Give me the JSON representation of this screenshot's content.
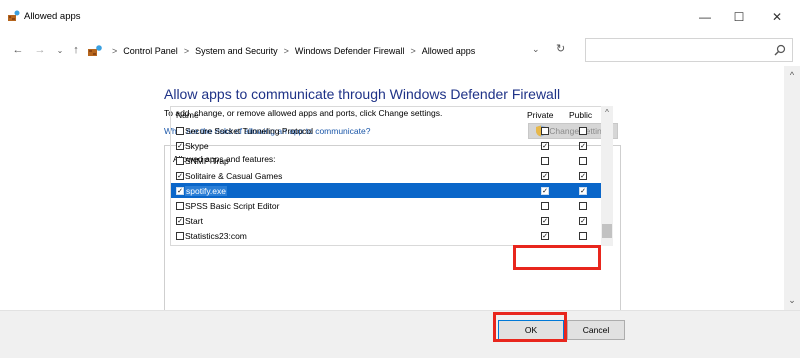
{
  "window": {
    "title": "Allowed apps",
    "minimize_glyph": "—",
    "maximize_glyph": "☐",
    "close_glyph": "✕"
  },
  "nav": {
    "back_glyph": "←",
    "forward_glyph": "→",
    "recent_glyph": "⌄",
    "up_glyph": "↑",
    "crumbs": [
      "Control Panel",
      "System and Security",
      "Windows Defender Firewall",
      "Allowed apps"
    ],
    "separator": ">",
    "dropdown_glyph": "⌄",
    "refresh_glyph": "↻",
    "search_placeholder": ""
  },
  "main": {
    "heading": "Allow apps to communicate through Windows Defender Firewall",
    "subtitle": "To add, change, or remove allowed apps and ports, click Change settings.",
    "risk_link": "What are the risks of allowing an app to communicate?",
    "change_settings_label": "Change settings",
    "group_label": "Allowed apps and features:",
    "columns": {
      "name": "Name",
      "private": "Private",
      "public": "Public"
    },
    "rows": [
      {
        "name": "Secure Socket Tunneling Protocol",
        "enabled": false,
        "private": false,
        "public": false,
        "selected": false
      },
      {
        "name": "Skype",
        "enabled": true,
        "private": true,
        "public": true,
        "selected": false
      },
      {
        "name": "SNMP Trap",
        "enabled": false,
        "private": false,
        "public": false,
        "selected": false
      },
      {
        "name": "Solitaire & Casual Games",
        "enabled": true,
        "private": true,
        "public": true,
        "selected": false
      },
      {
        "name": "spotify.exe",
        "enabled": true,
        "private": true,
        "public": true,
        "selected": true
      },
      {
        "name": "SPSS Basic Script Editor",
        "enabled": false,
        "private": false,
        "public": false,
        "selected": false
      },
      {
        "name": "Start",
        "enabled": true,
        "private": true,
        "public": true,
        "selected": false
      },
      {
        "name": "Statistics23:com",
        "enabled": false,
        "private": true,
        "public": false,
        "selected": false
      }
    ]
  },
  "buttons": {
    "ok": "OK",
    "cancel": "Cancel"
  },
  "colors": {
    "accent": "#0a66c9",
    "heading": "#1e3287",
    "link": "#1a56a8",
    "highlight": "#e8261d"
  }
}
